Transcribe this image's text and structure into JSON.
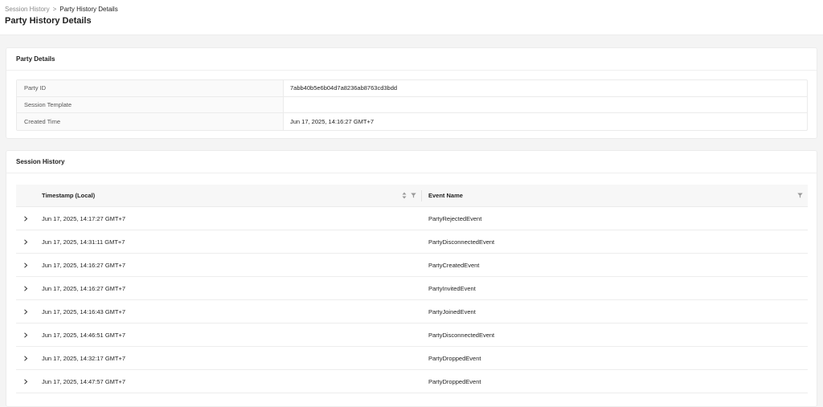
{
  "breadcrumb": {
    "parent": "Session History",
    "separator": ">",
    "current": "Party History Details"
  },
  "page_title": "Party History Details",
  "party_details": {
    "title": "Party Details",
    "rows": [
      {
        "key": "Party ID",
        "value": "7abb40b5e6b04d7a8236ab8763cd3bdd"
      },
      {
        "key": "Session Template",
        "value": ""
      },
      {
        "key": "Created Time",
        "value": "Jun 17, 2025, 14:16:27 GMT+7"
      }
    ]
  },
  "session_history": {
    "title": "Session History",
    "columns": {
      "timestamp": "Timestamp (Local)",
      "event": "Event Name"
    },
    "icons": {
      "sort": "sort-icon",
      "filter": "filter-icon",
      "expand": "chevron-right-icon"
    },
    "rows": [
      {
        "timestamp": "Jun 17, 2025, 14:17:27 GMT+7",
        "event": "PartyRejectedEvent"
      },
      {
        "timestamp": "Jun 17, 2025, 14:31:11 GMT+7",
        "event": "PartyDisconnectedEvent"
      },
      {
        "timestamp": "Jun 17, 2025, 14:16:27 GMT+7",
        "event": "PartyCreatedEvent"
      },
      {
        "timestamp": "Jun 17, 2025, 14:16:27 GMT+7",
        "event": "PartyInvitedEvent"
      },
      {
        "timestamp": "Jun 17, 2025, 14:16:43 GMT+7",
        "event": "PartyJoinedEvent"
      },
      {
        "timestamp": "Jun 17, 2025, 14:46:51 GMT+7",
        "event": "PartyDisconnectedEvent"
      },
      {
        "timestamp": "Jun 17, 2025, 14:32:17 GMT+7",
        "event": "PartyDroppedEvent"
      },
      {
        "timestamp": "Jun 17, 2025, 14:47:57 GMT+7",
        "event": "PartyDroppedEvent"
      }
    ]
  }
}
